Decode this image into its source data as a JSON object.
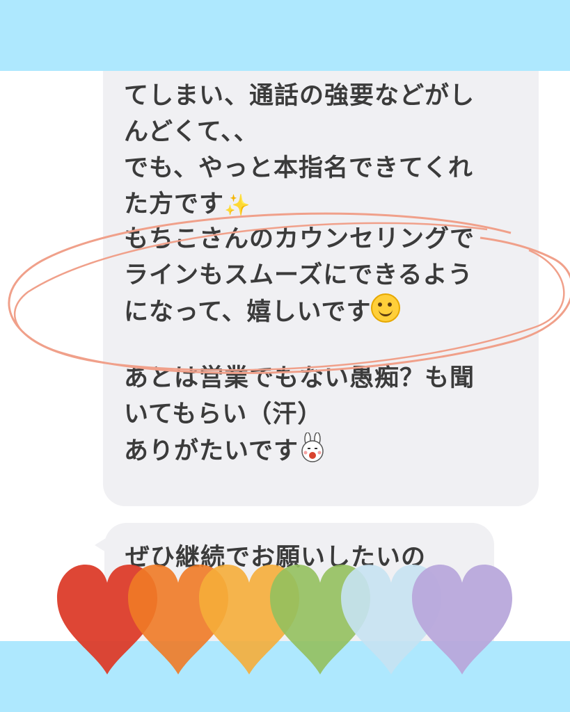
{
  "message1": {
    "paragraph1": [
      "てしまい、通話の強要などがし",
      "んどくて、、",
      "でも、やっと本指名できてくれ",
      "た方です"
    ],
    "paragraph2": [
      "もちこさんのカウンセリングで",
      "ラインもスムーズにできるよう",
      "になって、嬉しいです"
    ],
    "paragraph3": [
      "あとは営業でもない愚痴？も聞",
      "いてもらい（汗）",
      "ありがたいです"
    ]
  },
  "message2": {
    "line1": "ぜひ継続でお願いしたいの"
  },
  "icons": {
    "sparkle": "sparkles-emoji-icon",
    "smile": "smiling-face-emoji-icon",
    "bunny": "bunny-sticker-icon"
  },
  "colors": {
    "band": "#aee8fe",
    "bubble": "#f0f0f3",
    "highlight_circle": "#f0a08a",
    "hearts": [
      "#dc3c2a",
      "#ef7a26",
      "#f5ad3a",
      "#93c05e",
      "#c7e2f2",
      "#b8a8db"
    ]
  }
}
